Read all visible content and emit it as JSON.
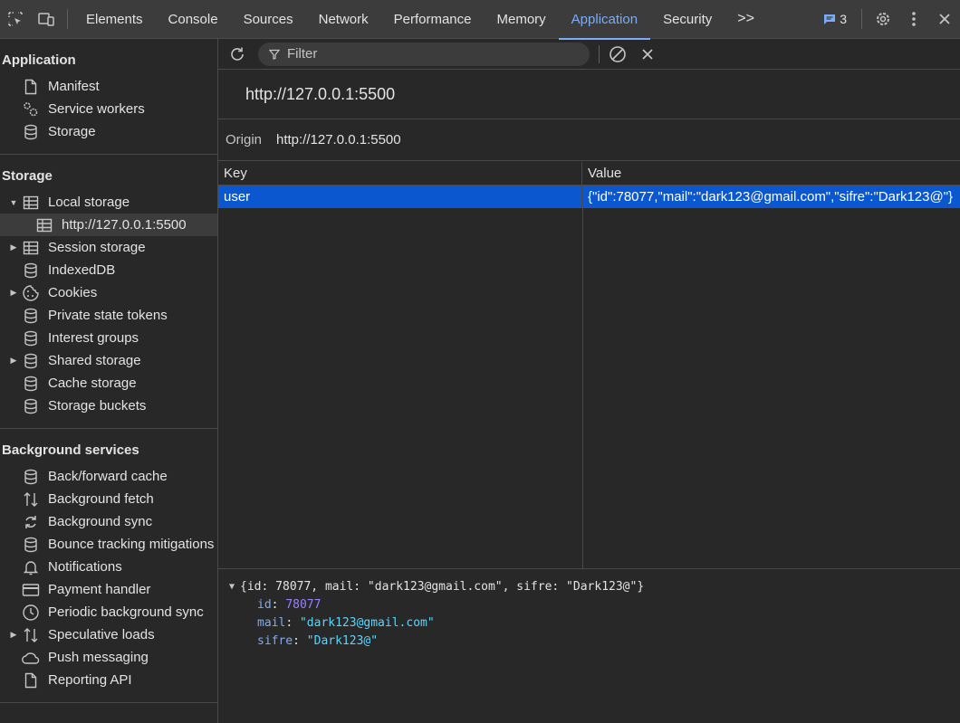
{
  "tabs": [
    "Elements",
    "Console",
    "Sources",
    "Network",
    "Performance",
    "Memory",
    "Application",
    "Security"
  ],
  "active_tab": "Application",
  "more_tabs": ">>",
  "issues_count": "3",
  "sidebar": {
    "application": {
      "title": "Application",
      "items": [
        "Manifest",
        "Service workers",
        "Storage"
      ]
    },
    "storage": {
      "title": "Storage",
      "local_storage": "Local storage",
      "local_storage_origin": "http://127.0.0.1:5500",
      "items": [
        "Session storage",
        "IndexedDB",
        "Cookies",
        "Private state tokens",
        "Interest groups",
        "Shared storage",
        "Cache storage",
        "Storage buckets"
      ]
    },
    "background": {
      "title": "Background services",
      "items": [
        "Back/forward cache",
        "Background fetch",
        "Background sync",
        "Bounce tracking mitigations",
        "Notifications",
        "Payment handler",
        "Periodic background sync",
        "Speculative loads",
        "Push messaging",
        "Reporting API"
      ]
    }
  },
  "toolbar": {
    "filter_placeholder": "Filter"
  },
  "origin_title": "http://127.0.0.1:5500",
  "origin_label": "Origin",
  "origin_value": "http://127.0.0.1:5500",
  "table": {
    "headers": [
      "Key",
      "Value"
    ],
    "rows": [
      {
        "key": "user",
        "value": "{\"id\":78077,\"mail\":\"dark123@gmail.com\",\"sifre\":\"Dark123@\"}"
      }
    ]
  },
  "preview": {
    "summary": "{id: 78077, mail: \"dark123@gmail.com\", sifre: \"Dark123@\"}",
    "props": [
      {
        "key": "id",
        "value": "78077"
      },
      {
        "key": "mail",
        "value": "\"dark123@gmail.com\""
      },
      {
        "key": "sifre",
        "value": "\"Dark123@\""
      }
    ]
  },
  "colors": {
    "accent": "#7cacf8",
    "selection": "#0b57d0",
    "bg": "#282828",
    "toolbar_bg": "#3c3c3c"
  }
}
